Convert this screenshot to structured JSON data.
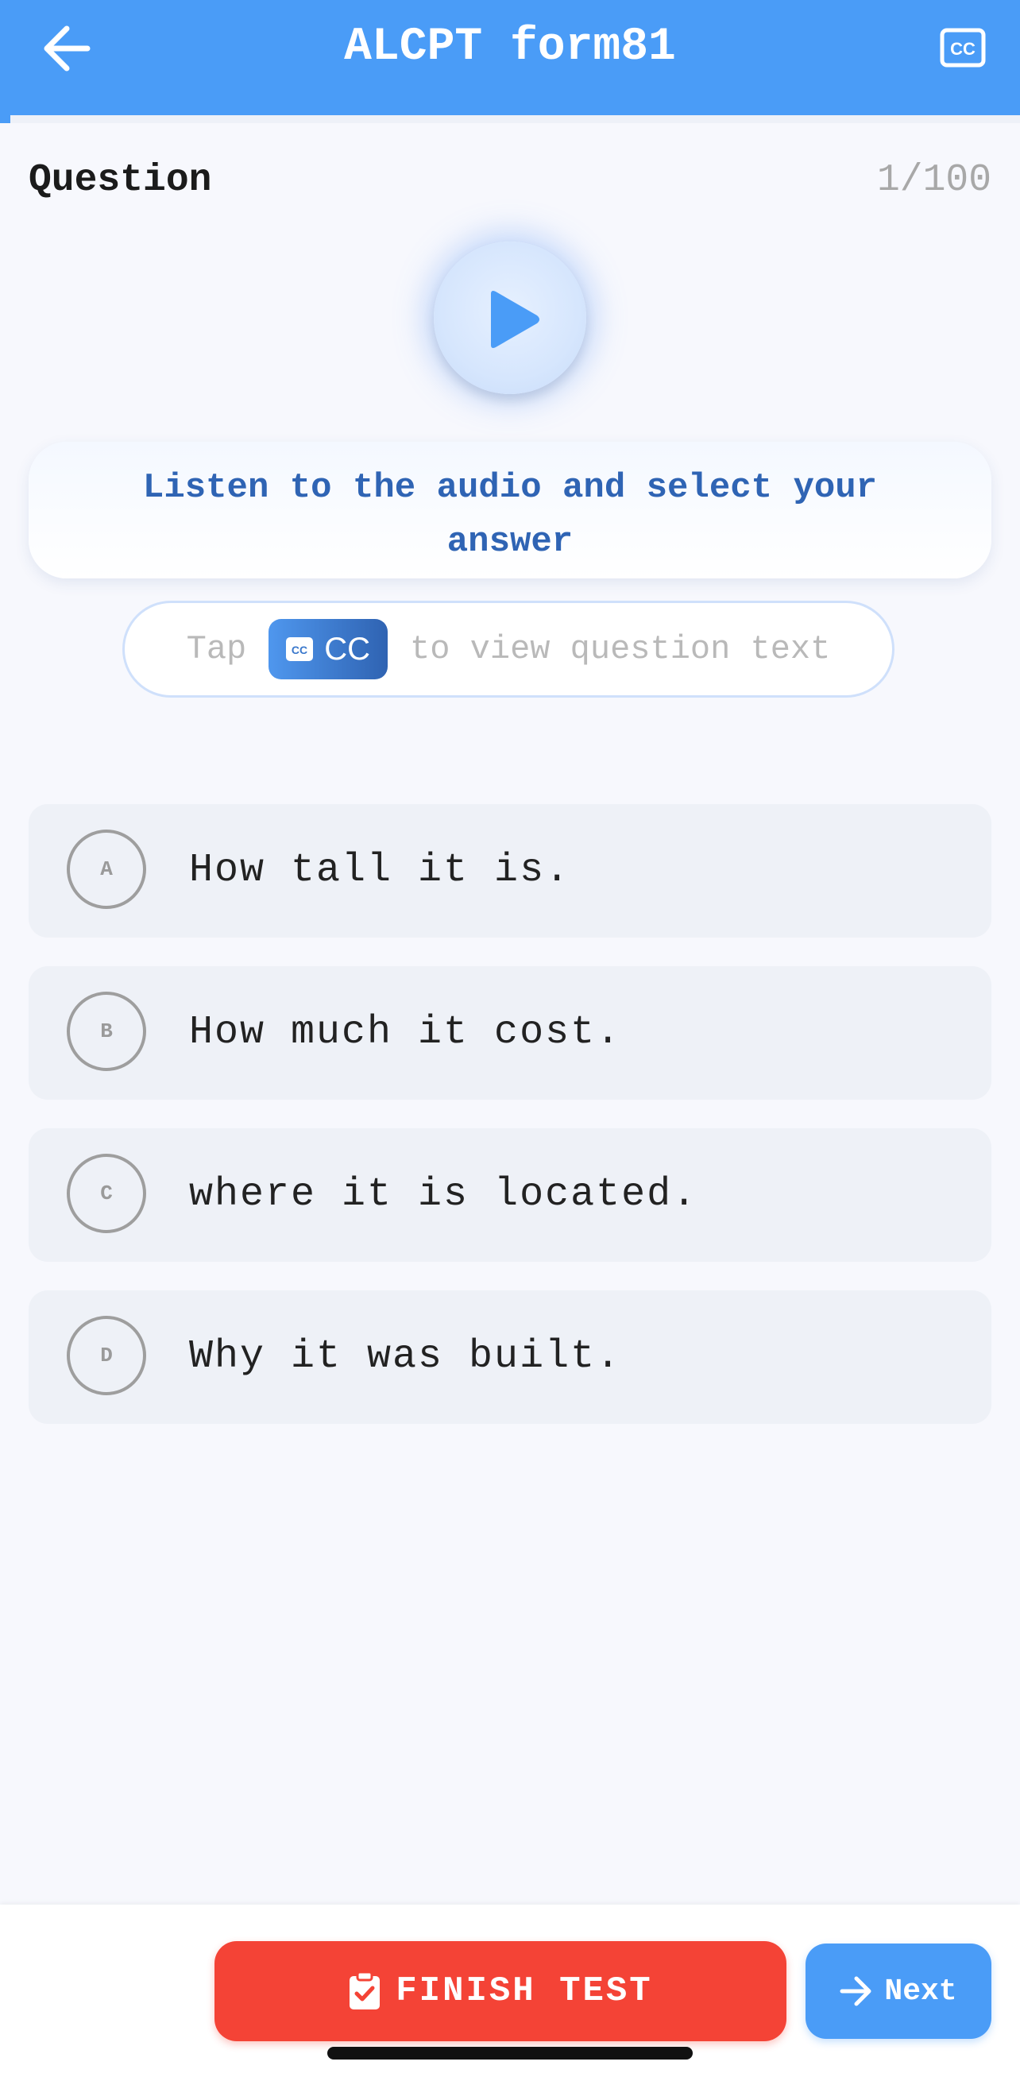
{
  "header": {
    "title": "ALCPT form81",
    "back_icon": "arrow-left-icon",
    "cc_icon": "closed-captions-icon",
    "progress_fraction": 0.01,
    "accent_color": "#4a9cf7"
  },
  "question": {
    "label": "Question",
    "counter": "1/100",
    "play_icon": "play-icon",
    "instruction": "Listen to the audio and select your answer",
    "hint_prefix": "Tap",
    "hint_chip": "CC",
    "hint_suffix": "to view question text"
  },
  "options": [
    {
      "letter": "A",
      "text": "How tall it is."
    },
    {
      "letter": "B",
      "text": "How much it cost."
    },
    {
      "letter": "C",
      "text": "where it is located."
    },
    {
      "letter": "D",
      "text": "Why it was built."
    }
  ],
  "footer": {
    "finish_label": "FINISH TEST",
    "finish_icon": "clipboard-check-icon",
    "finish_color": "#f44336",
    "next_label": "Next",
    "next_icon": "arrow-right-icon"
  }
}
